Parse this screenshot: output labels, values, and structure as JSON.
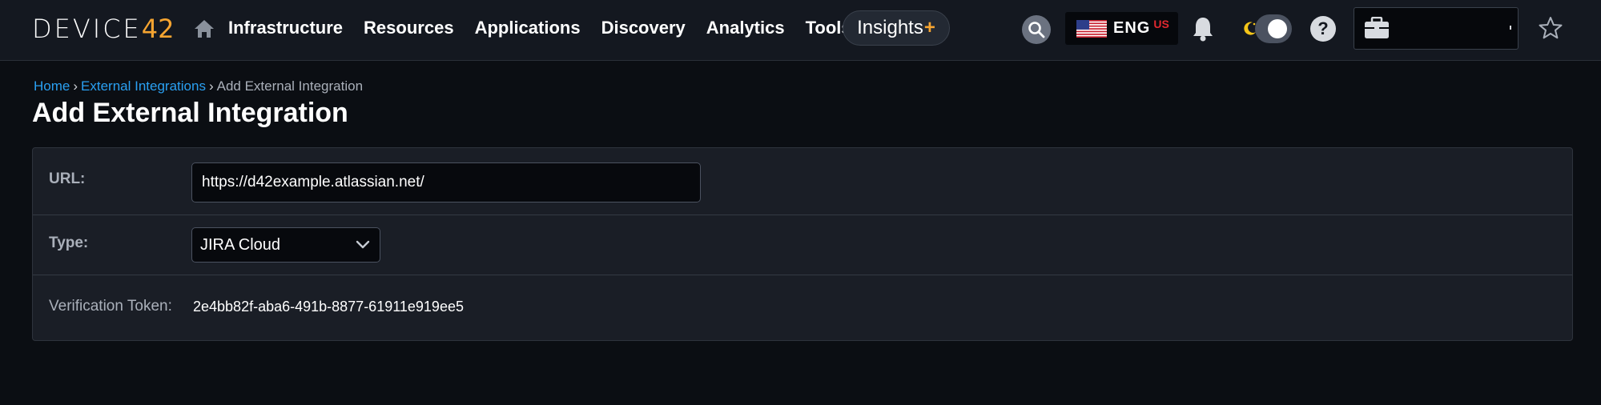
{
  "app": {
    "logo_text": "DEVICE",
    "logo_number": "42"
  },
  "nav": {
    "items": [
      {
        "label": "Infrastructure"
      },
      {
        "label": "Resources"
      },
      {
        "label": "Applications"
      },
      {
        "label": "Discovery"
      },
      {
        "label": "Analytics"
      },
      {
        "label": "Tools"
      }
    ],
    "insights_label": "Insights",
    "insights_plus": "+",
    "language_code": "ENG",
    "language_region": "US"
  },
  "icons": {
    "home": "home-icon",
    "search": "search-icon",
    "flag": "us-flag-icon",
    "bell": "bell-icon",
    "theme": "moon-icon",
    "help": "help-icon",
    "briefcase": "briefcase-icon",
    "star": "star-icon"
  },
  "colors": {
    "accent_orange": "#f5a431",
    "link_blue": "#2aa0f2",
    "region_red": "#e0282f",
    "background": "#0b0e13",
    "card": "#1a1e26"
  },
  "breadcrumb": {
    "home": "Home",
    "parent": "External Integrations",
    "current": "Add External Integration",
    "separator": "›"
  },
  "page": {
    "title": "Add External Integration"
  },
  "form": {
    "url_label": "URL:",
    "url_value": "https://d42example.atlassian.net/",
    "type_label": "Type:",
    "type_value": "JIRA Cloud",
    "token_label": "Verification Token:",
    "token_value": "2e4bb82f-aba6-491b-8877-61911e919ee5"
  },
  "help_glyph": "?"
}
